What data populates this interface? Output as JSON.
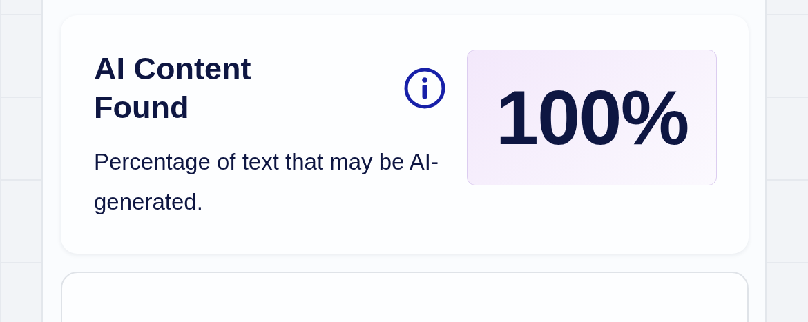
{
  "card": {
    "title": "AI Content Found",
    "description": "Percentage of text that may be AI-generated.",
    "score": "100%"
  }
}
